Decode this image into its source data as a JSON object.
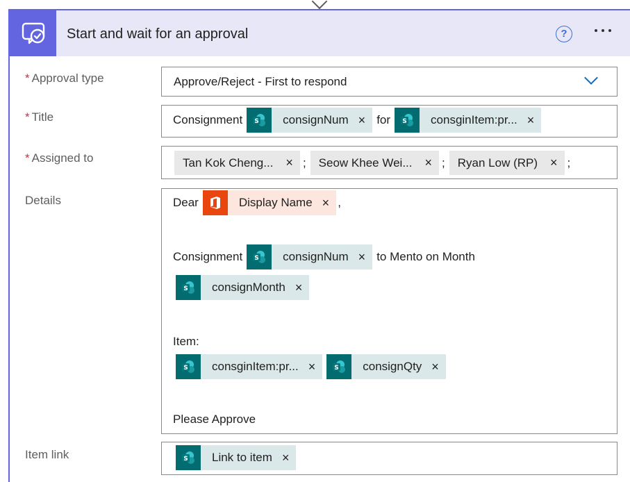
{
  "card": {
    "title": "Start and wait for an approval",
    "help_glyph": "?",
    "accent_color": "#6264e0"
  },
  "fields": {
    "approval_type": {
      "label": "Approval type",
      "required_mark": "*",
      "value": "Approve/Reject - First to respond"
    },
    "title": {
      "label": "Title",
      "required_mark": "*",
      "text_1": "Consignment",
      "token_1": "consignNum",
      "text_2": "for",
      "token_2": "consginItem:pr..."
    },
    "assigned_to": {
      "label": "Assigned to",
      "required_mark": "*",
      "people": [
        "Tan Kok Cheng...",
        "Seow Khee Wei...",
        "Ryan Low (RP)"
      ],
      "separator": ";"
    },
    "details": {
      "label": "Details",
      "dear": "Dear",
      "display_name_token": "Display Name",
      "comma": ",",
      "consignment_text": "Consignment",
      "consign_num_token": "consignNum",
      "to_mento_text": "to Mento on Month",
      "consign_month_token": "consignMonth",
      "item_text": "Item:",
      "consgin_item_token": "consginItem:pr...",
      "consign_qty_token": "consignQty",
      "please_approve": "Please Approve"
    },
    "item_link": {
      "label": "Item link",
      "token": "Link to item"
    }
  },
  "token_remove_glyph": "×",
  "icons": {
    "header": "approval-check-icon",
    "sharepoint": "sharepoint-icon",
    "office": "office-icon"
  },
  "colors": {
    "sharepoint": "#036c70",
    "office": "#e9450f",
    "required": "#c4314b",
    "link_blue": "#0f6cbd"
  }
}
